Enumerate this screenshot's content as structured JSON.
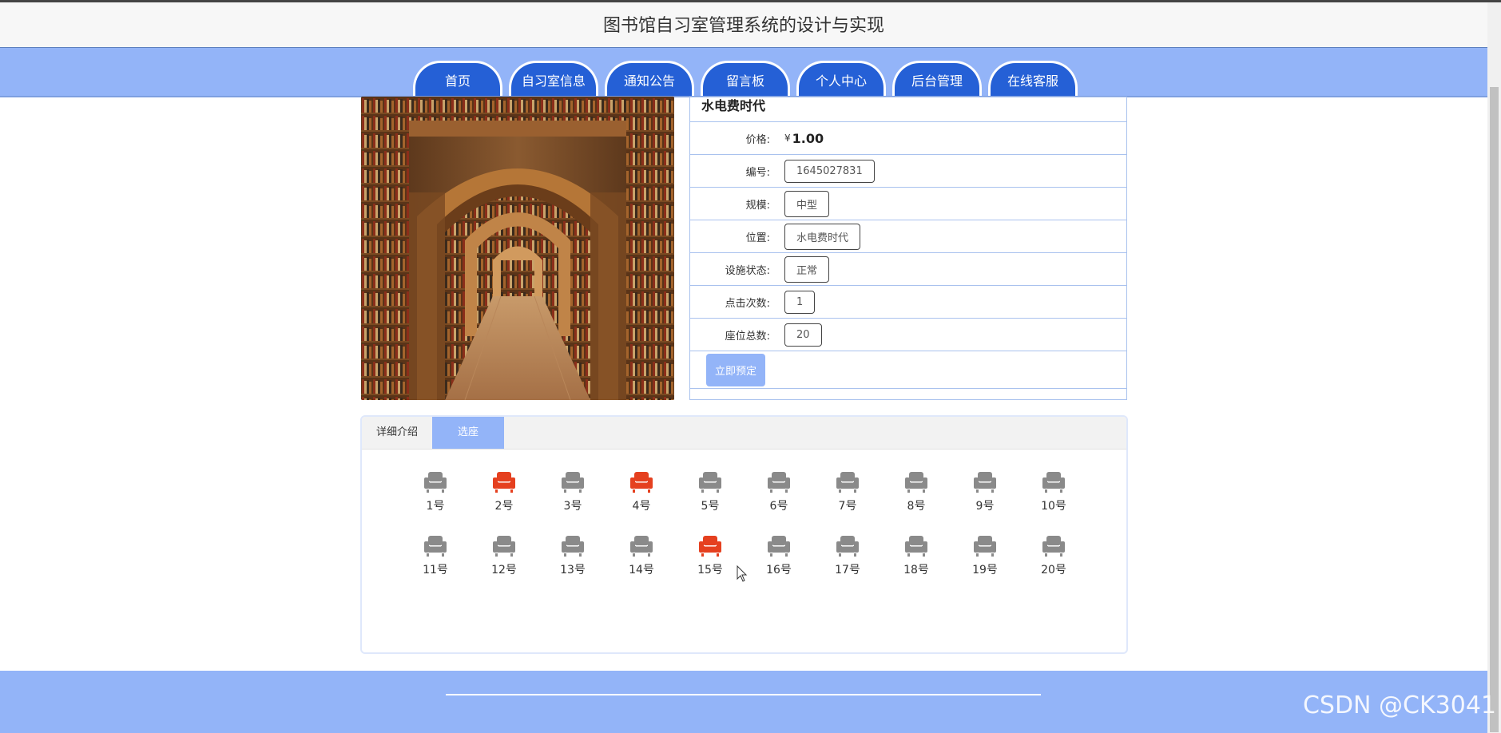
{
  "header": {
    "title": "图书馆自习室管理系统的设计与实现"
  },
  "nav": {
    "tabs": [
      {
        "label": "首页"
      },
      {
        "label": "自习室信息"
      },
      {
        "label": "通知公告"
      },
      {
        "label": "留言板"
      },
      {
        "label": "个人中心"
      },
      {
        "label": "后台管理"
      },
      {
        "label": "在线客服"
      }
    ]
  },
  "room": {
    "name": "水电费时代",
    "price_label": "价格:",
    "price_symbol": "¥",
    "price": "1.00",
    "fields": [
      {
        "label": "编号:",
        "value": "1645027831"
      },
      {
        "label": "规模:",
        "value": "中型"
      },
      {
        "label": "位置:",
        "value": "水电费时代"
      },
      {
        "label": "设施状态:",
        "value": "正常"
      },
      {
        "label": "点击次数:",
        "value": "1"
      },
      {
        "label": "座位总数:",
        "value": "20"
      }
    ],
    "book_button": "立即预定"
  },
  "tabs": {
    "detail": "详细介绍",
    "select_seat": "选座"
  },
  "seats": {
    "colors": {
      "available": "#8a8a8a",
      "taken": "#e5401f"
    },
    "items": [
      {
        "label": "1号",
        "status": "available"
      },
      {
        "label": "2号",
        "status": "taken"
      },
      {
        "label": "3号",
        "status": "available"
      },
      {
        "label": "4号",
        "status": "taken"
      },
      {
        "label": "5号",
        "status": "available"
      },
      {
        "label": "6号",
        "status": "available"
      },
      {
        "label": "7号",
        "status": "available"
      },
      {
        "label": "8号",
        "status": "available"
      },
      {
        "label": "9号",
        "status": "available"
      },
      {
        "label": "10号",
        "status": "available"
      },
      {
        "label": "11号",
        "status": "available"
      },
      {
        "label": "12号",
        "status": "available"
      },
      {
        "label": "13号",
        "status": "available"
      },
      {
        "label": "14号",
        "status": "available"
      },
      {
        "label": "15号",
        "status": "taken"
      },
      {
        "label": "16号",
        "status": "available"
      },
      {
        "label": "17号",
        "status": "available"
      },
      {
        "label": "18号",
        "status": "available"
      },
      {
        "label": "19号",
        "status": "available"
      },
      {
        "label": "20号",
        "status": "available"
      }
    ]
  },
  "watermark": "CSDN @CK3041",
  "colors": {
    "nav_bg": "#93b4f8",
    "tab_bg": "#2560d6",
    "footer_bg": "#93b4f8"
  }
}
